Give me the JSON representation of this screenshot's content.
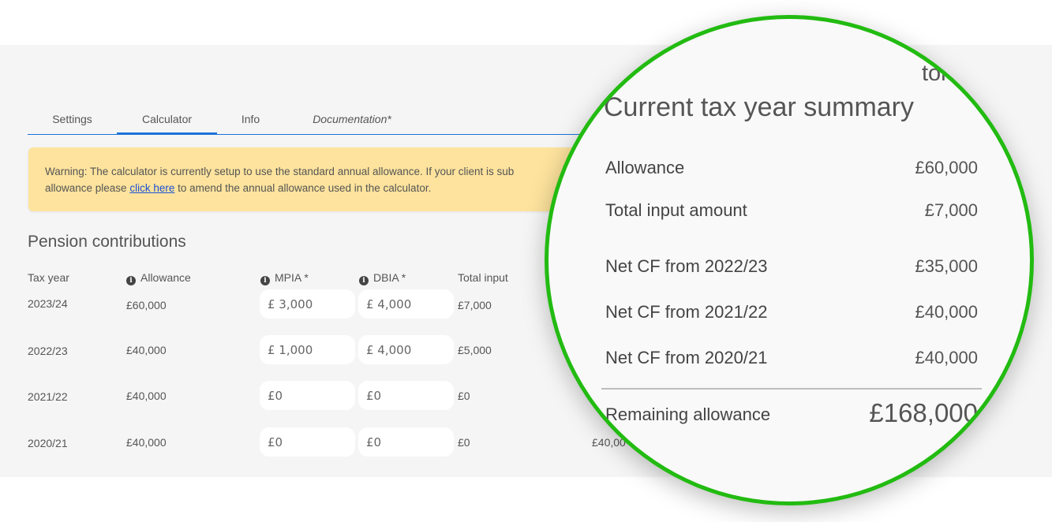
{
  "page": {
    "title_partial": "tor"
  },
  "tabs": [
    {
      "label": "Settings",
      "active": false
    },
    {
      "label": "Calculator",
      "active": true
    },
    {
      "label": "Info",
      "active": false
    },
    {
      "label": "Documentation*",
      "active": false
    }
  ],
  "warning": {
    "text_before": "Warning: The calculator is currently setup to use the standard annual allowance. If your client is sub",
    "text_line2_before": "allowance please ",
    "link_label": "click here",
    "text_after": " to amend the annual allowance used in the calculator."
  },
  "contributions": {
    "title": "Pension contributions",
    "headers": {
      "tax_year": "Tax year",
      "allowance": "Allowance",
      "mpia": "MPIA *",
      "dbia": "DBIA *",
      "total_input": "Total input"
    },
    "rows": [
      {
        "tax_year": "2023/24",
        "allowance": "£60,000",
        "mpia": "£ 3,000",
        "dbia": "£ 4,000",
        "total_input": "£7,000"
      },
      {
        "tax_year": "2022/23",
        "allowance": "£40,000",
        "mpia": "£ 1,000",
        "dbia": "£ 4,000",
        "total_input": "£5,000"
      },
      {
        "tax_year": "2021/22",
        "allowance": "£40,000",
        "mpia": "£0",
        "dbia": "£0",
        "total_input": "£0"
      },
      {
        "tax_year": "2020/21",
        "allowance": "£40,000",
        "mpia": "£0",
        "dbia": "£0",
        "total_input": "£0"
      }
    ],
    "partial_carry_forward": "£40,00"
  },
  "summary": {
    "title_partial": "tor",
    "heading": "Current tax year summary",
    "rows": [
      {
        "label": "Allowance",
        "value": "£60,000"
      },
      {
        "label": "Total input amount",
        "value": "£7,000"
      },
      {
        "label": "Net CF from 2022/23",
        "value": "£35,000"
      },
      {
        "label": "Net CF from 2021/22",
        "value": "£40,000"
      },
      {
        "label": "Net CF from 2020/21",
        "value": "£40,000"
      }
    ],
    "total": {
      "label": "Remaining allowance",
      "value": "£168,000"
    }
  },
  "colors": {
    "accent": "#1a73d9",
    "warning_bg": "#fde39d",
    "magnifier_ring": "#22bb11"
  }
}
